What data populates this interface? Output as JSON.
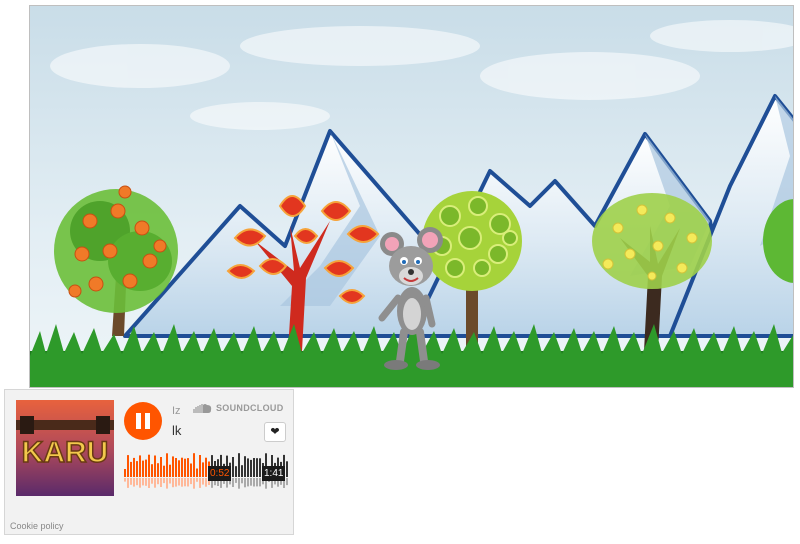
{
  "game": {
    "scene": "mountain-meadow",
    "character": "cartoon-mouse",
    "trees": [
      "orange-fruit-tree",
      "red-leaf-tree",
      "green-circle-tree",
      "lemon-tree",
      "green-tree-edge"
    ]
  },
  "player": {
    "brand": "SOUNDCLOUD",
    "artist": "Iz",
    "track_title": "lk",
    "elapsed": "0:52",
    "duration": "1:41",
    "progress": 0.51,
    "state": "playing",
    "like_icon": "heart-icon",
    "play_icon": "pause-icon",
    "accent_color": "#ff5500",
    "cookie_link": "Cookie policy"
  },
  "artwork": {
    "text": "KARU",
    "colors": [
      "#e05a3a",
      "#8a3a7a",
      "#f2c94c"
    ]
  }
}
